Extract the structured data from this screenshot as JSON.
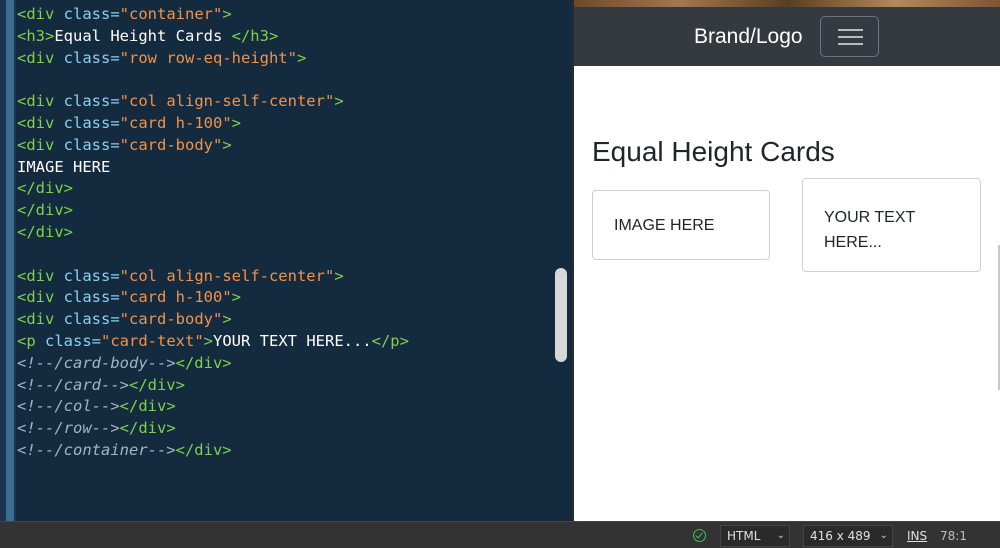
{
  "editor": {
    "lines": [
      [
        {
          "c": "tag",
          "t": "<div "
        },
        {
          "c": "attr",
          "t": "class="
        },
        {
          "c": "str",
          "t": "\"container\""
        },
        {
          "c": "tag",
          "t": ">"
        }
      ],
      [
        {
          "c": "tag",
          "t": "<h3>"
        },
        {
          "c": "txt",
          "t": "Equal Height Cards "
        },
        {
          "c": "tag",
          "t": "</h3>"
        }
      ],
      [
        {
          "c": "tag",
          "t": "<div "
        },
        {
          "c": "attr",
          "t": "class="
        },
        {
          "c": "str",
          "t": "\"row row-eq-height\""
        },
        {
          "c": "tag",
          "t": ">"
        }
      ],
      [],
      [
        {
          "c": "tag",
          "t": "<div "
        },
        {
          "c": "attr",
          "t": "class="
        },
        {
          "c": "str",
          "t": "\"col align-self-center\""
        },
        {
          "c": "tag",
          "t": ">"
        }
      ],
      [
        {
          "c": "tag",
          "t": "<div "
        },
        {
          "c": "attr",
          "t": "class="
        },
        {
          "c": "str",
          "t": "\"card h-100\""
        },
        {
          "c": "tag",
          "t": ">"
        }
      ],
      [
        {
          "c": "tag",
          "t": "<div "
        },
        {
          "c": "attr",
          "t": "class="
        },
        {
          "c": "str",
          "t": "\"card-body\""
        },
        {
          "c": "tag",
          "t": ">"
        }
      ],
      [
        {
          "c": "txt",
          "t": "IMAGE HERE"
        }
      ],
      [
        {
          "c": "tag",
          "t": "</div>"
        }
      ],
      [
        {
          "c": "tag",
          "t": "</div>"
        }
      ],
      [
        {
          "c": "tag",
          "t": "</div>"
        }
      ],
      [],
      [
        {
          "c": "tag",
          "t": "<div "
        },
        {
          "c": "attr",
          "t": "class="
        },
        {
          "c": "str",
          "t": "\"col align-self-center\""
        },
        {
          "c": "tag",
          "t": ">"
        }
      ],
      [
        {
          "c": "tag",
          "t": "<div "
        },
        {
          "c": "attr",
          "t": "class="
        },
        {
          "c": "str",
          "t": "\"card h-100\""
        },
        {
          "c": "tag",
          "t": ">"
        }
      ],
      [
        {
          "c": "tag",
          "t": "<div "
        },
        {
          "c": "attr",
          "t": "class="
        },
        {
          "c": "str",
          "t": "\"card-body\""
        },
        {
          "c": "tag",
          "t": ">"
        }
      ],
      [
        {
          "c": "tag",
          "t": "<p "
        },
        {
          "c": "attr",
          "t": "class="
        },
        {
          "c": "str",
          "t": "\"card-text\""
        },
        {
          "c": "tag",
          "t": ">"
        },
        {
          "c": "txt",
          "t": "YOUR TEXT HERE..."
        },
        {
          "c": "tag",
          "t": "</p>"
        }
      ],
      [
        {
          "c": "cmt",
          "t": "<!--/card-body-->"
        },
        {
          "c": "tag",
          "t": "</div>"
        }
      ],
      [
        {
          "c": "cmt",
          "t": "<!--/card-->"
        },
        {
          "c": "tag",
          "t": "</div>"
        }
      ],
      [
        {
          "c": "cmt",
          "t": "<!--/col-->"
        },
        {
          "c": "tag",
          "t": "</div>"
        }
      ],
      [
        {
          "c": "cmt",
          "t": "<!--/row-->"
        },
        {
          "c": "tag",
          "t": "</div>"
        }
      ],
      [
        {
          "c": "cmt",
          "t": "<!--/container-->"
        },
        {
          "c": "tag",
          "t": "</div>"
        }
      ]
    ]
  },
  "preview": {
    "brand": "Brand/Logo",
    "title": "Equal Height Cards",
    "card_image_text": "IMAGE HERE",
    "card_text": "YOUR TEXT HERE..."
  },
  "statusbar": {
    "language": "HTML",
    "dimensions": "416 x 489",
    "mode": "INS",
    "cursor": "78:1"
  },
  "colors": {
    "editor_bg": "#142a3f",
    "tag": "#7fd14a",
    "attribute": "#8ad0f0",
    "string": "#f0934c",
    "comment": "#a3b4c4",
    "navbar_bg": "#343a40"
  },
  "icons": {
    "lint_status": "check-circle-icon",
    "menu": "hamburger-icon",
    "dropdown": "chevron-down-icon"
  }
}
